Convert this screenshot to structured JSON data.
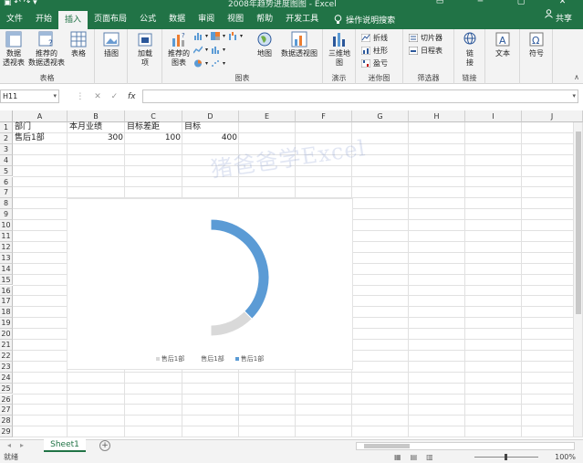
{
  "app": {
    "title": "2008年趋势进度图图 - Excel",
    "share_label": "共享",
    "help_search": "操作说明搜索"
  },
  "tabs": [
    "文件",
    "开始",
    "插入",
    "页面布局",
    "公式",
    "数据",
    "审阅",
    "视图",
    "帮助",
    "开发工具"
  ],
  "active_tab": "插入",
  "ribbon": {
    "tables_group": {
      "label": "表格",
      "pivot": "数据\n透视表",
      "recommended_pivot": "推荐的\n数据透视表",
      "table": "表格"
    },
    "illustrations": {
      "label": "插图"
    },
    "addins": {
      "label": "加载\n项"
    },
    "charts_group": {
      "label": "图表",
      "recommended": "推荐的\n图表",
      "map": "地图",
      "pivot_chart": "数据透视图"
    },
    "tours_group": {
      "label": "演示",
      "3d_map": "三维地\n图"
    },
    "sparklines_group": {
      "label": "迷你图",
      "line": "折线",
      "column": "柱形",
      "winloss": "盈亏"
    },
    "filters_group": {
      "label": "筛选器",
      "slicer": "切片器",
      "timeline": "日程表"
    },
    "links_group": {
      "label": "链接",
      "link": "链\n接"
    },
    "text_group": {
      "label": "文本"
    },
    "symbols_group": {
      "label": "符号"
    }
  },
  "formula_bar": {
    "name_box": "H11",
    "formula": "",
    "fx": "fx"
  },
  "columns": [
    "A",
    "B",
    "C",
    "D",
    "E",
    "F",
    "G",
    "H",
    "I",
    "J"
  ],
  "rows": [
    "1",
    "2",
    "3",
    "4",
    "5",
    "6",
    "7",
    "8",
    "9",
    "10",
    "11",
    "12",
    "13",
    "14",
    "15",
    "16",
    "17",
    "18",
    "19",
    "20",
    "21",
    "22",
    "23",
    "24",
    "25",
    "26",
    "27",
    "28",
    "29"
  ],
  "cells": {
    "A1": "部门",
    "B1": "本月业绩",
    "C1": "目标差距",
    "D1": "目标",
    "A2": "售后1部",
    "B2": "300",
    "C2": "100",
    "D2": "400"
  },
  "watermark": "猪爸爸学Excel",
  "chart_data": {
    "type": "pie",
    "variant": "doughnut",
    "title": "",
    "categories": [
      "售后1部",
      "售后1部",
      "售后1部"
    ],
    "values": [
      300,
      100,
      400
    ],
    "colors": [
      "#5b9bd5",
      "#d9d9d9",
      "#ffffff"
    ],
    "legend": [
      "售后1部",
      "售后1部",
      "售后1部"
    ],
    "legend_position": "bottom"
  },
  "sheet": {
    "name": "Sheet1"
  },
  "status": {
    "ready": "就绪",
    "zoom": "100%"
  },
  "colors": {
    "brand": "#217346",
    "accent_blue": "#5b9bd5"
  }
}
